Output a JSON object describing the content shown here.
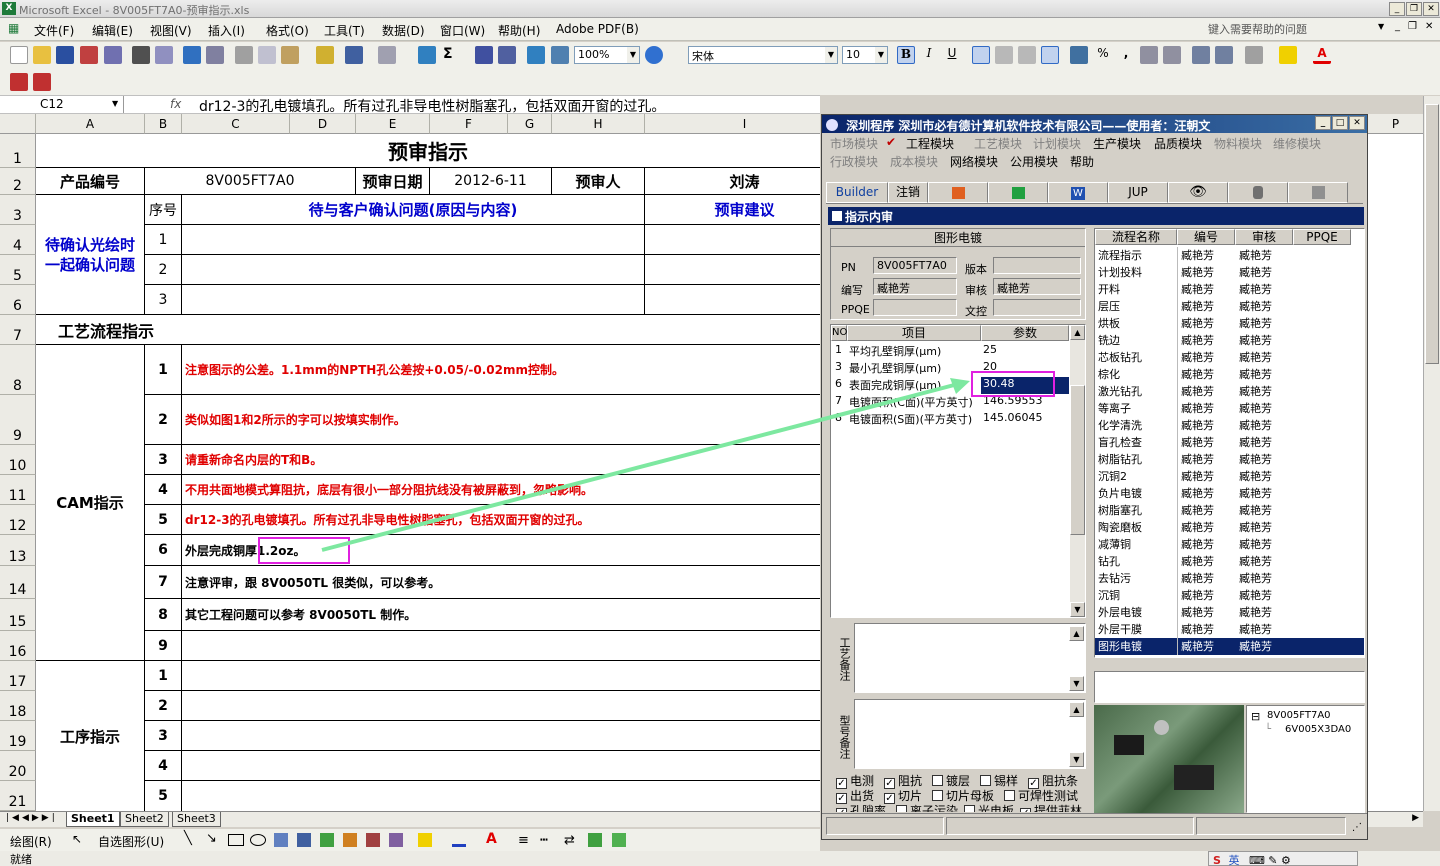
{
  "window": {
    "title": "Microsoft Excel - 8V005FT7A0-预审指示.xls",
    "help_placeholder": "键入需要帮助的问题"
  },
  "menus": [
    "文件(F)",
    "编辑(E)",
    "视图(V)",
    "插入(I)",
    "格式(O)",
    "工具(T)",
    "数据(D)",
    "窗口(W)",
    "帮助(H)",
    "Adobe PDF(B)"
  ],
  "toolbar": {
    "zoom": "100%",
    "font": "宋体",
    "size": "10",
    "bold": "B",
    "italic": "I",
    "underline": "U",
    "percent": "%"
  },
  "formula": {
    "cell": "C12",
    "fx": "fx",
    "text": "dr12-3的孔电镀填孔。所有过孔非导电性树脂塞孔，包括双面开窗的过孔。"
  },
  "columns": [
    "A",
    "B",
    "C",
    "D",
    "E",
    "F",
    "G",
    "H",
    "I"
  ],
  "extra_column": "P",
  "rows": [
    "1",
    "2",
    "3",
    "4",
    "5",
    "6",
    "7",
    "8",
    "9",
    "10",
    "11",
    "12",
    "13",
    "14",
    "15",
    "16",
    "17",
    "18",
    "19",
    "20",
    "21"
  ],
  "sheet": {
    "title": "预审指示",
    "product_label": "产品编号",
    "product_value": "8V005FT7A0",
    "date_label": "预审日期",
    "date_value": "2012-6-11",
    "person_label": "预审人",
    "person_value": "刘涛",
    "confirm_label": "待确认光绘时一起确认问题",
    "seq_label": "序号",
    "issue_label": "待与客户确认问题(原因与内容)",
    "suggest_label": "预审建议",
    "confirm_nums": [
      "1",
      "2",
      "3"
    ],
    "process_label": "工艺流程指示",
    "cam_label": "CAM指示",
    "cam_items": [
      {
        "n": "1",
        "t": "注意图示的公差。1.1mm的NPTH孔公差按+0.05/-0.02mm控制。"
      },
      {
        "n": "2",
        "t": "类似如图1和2所示的字可以按填实制作。"
      },
      {
        "n": "3",
        "t": "请重新命名内层的T和B。"
      },
      {
        "n": "4",
        "t": "不用共面地模式算阻抗，底层有很小一部分阻抗线没有被屏蔽到，忽略影响。"
      },
      {
        "n": "5",
        "t": "dr12-3的孔电镀填孔。所有过孔非导电性树脂塞孔，包括双面开窗的过孔。"
      },
      {
        "n": "6",
        "t": "外层完成铜厚1.2oz。"
      },
      {
        "n": "7",
        "t": "注意评审，跟 8V0050TL 很类似，可以参考。"
      },
      {
        "n": "8",
        "t": "其它工程问题可以参考 8V0050TL 制作。"
      },
      {
        "n": "9",
        "t": ""
      }
    ],
    "proc_label": "工序指示",
    "proc_nums": [
      "1",
      "2",
      "3",
      "4",
      "5"
    ]
  },
  "sheet_tabs": [
    "Sheet1",
    "Sheet2",
    "Sheet3"
  ],
  "drawbar": {
    "draw": "绘图(R)",
    "autoshape": "自选图形(U)"
  },
  "status": "就绪",
  "app": {
    "title": "深圳程序    深圳市必有德计算机软件技术有限公司——使用者：汪朝文",
    "menu_row1": [
      "市场模块",
      "工程模块",
      "工艺模块",
      "计划模块",
      "生产模块",
      "品质模块",
      "物料模块",
      "维修模块"
    ],
    "menu_row2": [
      "行政模块",
      "成本模块",
      "网络模块",
      "公用模块",
      "帮助"
    ],
    "tabs": [
      "Builder",
      "注销",
      "",
      "",
      "W",
      "JUP",
      "",
      "",
      ""
    ],
    "panel_title": "指示内审",
    "group_title": "图形电镀",
    "pn_label": "PN",
    "pn_value": "8V005FT7A0",
    "version_label": "版本",
    "version_value": "",
    "author_label": "编写",
    "author_value": "臧艳芳",
    "review_label": "审核",
    "review_value": "臧艳芳",
    "ppqe_label": "PPQE",
    "ppqe_value": "",
    "doc_label": "文控",
    "doc_value": "",
    "param_headers": [
      "NO",
      "项目",
      "参数"
    ],
    "params": [
      {
        "no": "1",
        "item": "平均孔壁铜厚(μm)",
        "val": "25"
      },
      {
        "no": "3",
        "item": "最小孔壁铜厚(μm)",
        "val": "20"
      },
      {
        "no": "6",
        "item": "表面完成铜厚(μm)",
        "val": "30.48"
      },
      {
        "no": "7",
        "item": "电镀面积(C面)(平方英寸)",
        "val": "146.59553"
      },
      {
        "no": "8",
        "item": "电镀面积(S面)(平方英寸)",
        "val": "145.06045"
      }
    ],
    "remark1": "工艺备注",
    "remark2": "型号备注",
    "checks": [
      [
        {
          "t": "电测",
          "c": true
        },
        {
          "t": "阻抗",
          "c": true
        },
        {
          "t": "镀层",
          "c": false
        },
        {
          "t": "锡样",
          "c": false
        },
        {
          "t": "阻抗条",
          "c": true
        }
      ],
      [
        {
          "t": "出货",
          "c": true
        },
        {
          "t": "切片",
          "c": true
        },
        {
          "t": "切片母板",
          "c": false
        },
        {
          "t": "可焊性测试",
          "c": false
        }
      ],
      [
        {
          "t": "孔隙率",
          "c": true
        },
        {
          "t": "离子污染",
          "c": false
        },
        {
          "t": "光电板",
          "c": false
        },
        {
          "t": "提供菲林",
          "c": true
        }
      ]
    ],
    "flow_headers": [
      "流程名称",
      "编号",
      "审核",
      "PPQE"
    ],
    "flows": [
      "流程指示",
      "计划投料",
      "开料",
      "层压",
      "烘板",
      "铣边",
      "芯板钻孔",
      "棕化",
      "激光钻孔",
      "等离子",
      "化学清洗",
      "盲孔检查",
      "树脂钻孔",
      "沉铜2",
      "负片电镀",
      "树脂塞孔",
      "陶瓷磨板",
      "减薄铜",
      "钻孔",
      "去钻污",
      "沉铜",
      "外层电镀",
      "外层干膜",
      "图形电镀"
    ],
    "flow_person": "臧艳芳",
    "tree": [
      "8V005FT7A0",
      "6V005X3DA0"
    ]
  },
  "taskbar_text": "英"
}
